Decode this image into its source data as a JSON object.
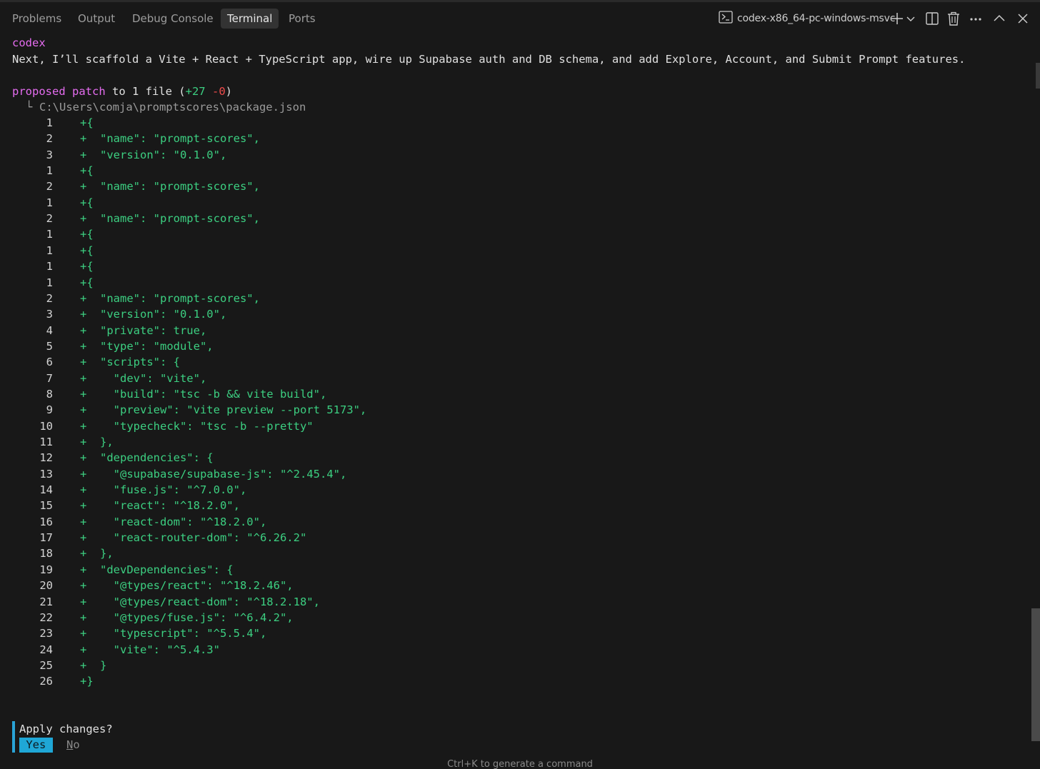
{
  "tabs": [
    {
      "label": "Problems"
    },
    {
      "label": "Output"
    },
    {
      "label": "Debug Console"
    },
    {
      "label": "Terminal",
      "active": true
    },
    {
      "label": "Ports"
    }
  ],
  "terminal_selector": {
    "icon": "terminal-icon",
    "label": "codex-x86_64-pc-windows-msvc"
  },
  "toolbar_icons": [
    "plus-icon",
    "chevron-down-icon",
    "split-icon",
    "trash-icon",
    "ellipsis-icon",
    "chevron-up-icon",
    "close-icon"
  ],
  "content": {
    "speaker": "codex",
    "message": "Next, I’ll scaffold a Vite + React + TypeScript app, wire up Supabase auth and DB schema, and add Explore, Account, and Submit Prompt features.",
    "patch_label": "proposed patch",
    "patch_to": " to 1 file (",
    "patch_added": "+27",
    "patch_space": " ",
    "patch_removed": "-0",
    "patch_close": ")",
    "file_tree_glyph": "└",
    "file_path": "C:\\Users\\comja\\promptscores\\package.json",
    "diff_lines": [
      {
        "num": "1",
        "code": "+{"
      },
      {
        "num": "2",
        "code": "+  \"name\": \"prompt-scores\","
      },
      {
        "num": "3",
        "code": "+  \"version\": \"0.1.0\","
      },
      {
        "num": "1",
        "code": "+{"
      },
      {
        "num": "2",
        "code": "+  \"name\": \"prompt-scores\","
      },
      {
        "num": "1",
        "code": "+{"
      },
      {
        "num": "2",
        "code": "+  \"name\": \"prompt-scores\","
      },
      {
        "num": "1",
        "code": "+{"
      },
      {
        "num": "1",
        "code": "+{"
      },
      {
        "num": "1",
        "code": "+{"
      },
      {
        "num": "1",
        "code": "+{"
      },
      {
        "num": "2",
        "code": "+  \"name\": \"prompt-scores\","
      },
      {
        "num": "3",
        "code": "+  \"version\": \"0.1.0\","
      },
      {
        "num": "4",
        "code": "+  \"private\": true,"
      },
      {
        "num": "5",
        "code": "+  \"type\": \"module\","
      },
      {
        "num": "6",
        "code": "+  \"scripts\": {"
      },
      {
        "num": "7",
        "code": "+    \"dev\": \"vite\","
      },
      {
        "num": "8",
        "code": "+    \"build\": \"tsc -b && vite build\","
      },
      {
        "num": "9",
        "code": "+    \"preview\": \"vite preview --port 5173\","
      },
      {
        "num": "10",
        "code": "+    \"typecheck\": \"tsc -b --pretty\""
      },
      {
        "num": "11",
        "code": "+  },"
      },
      {
        "num": "12",
        "code": "+  \"dependencies\": {"
      },
      {
        "num": "13",
        "code": "+    \"@supabase/supabase-js\": \"^2.45.4\","
      },
      {
        "num": "14",
        "code": "+    \"fuse.js\": \"^7.0.0\","
      },
      {
        "num": "15",
        "code": "+    \"react\": \"^18.2.0\","
      },
      {
        "num": "16",
        "code": "+    \"react-dom\": \"^18.2.0\","
      },
      {
        "num": "17",
        "code": "+    \"react-router-dom\": \"^6.26.2\""
      },
      {
        "num": "18",
        "code": "+  },"
      },
      {
        "num": "19",
        "code": "+  \"devDependencies\": {"
      },
      {
        "num": "20",
        "code": "+    \"@types/react\": \"^18.2.46\","
      },
      {
        "num": "21",
        "code": "+    \"@types/react-dom\": \"^18.2.18\","
      },
      {
        "num": "22",
        "code": "+    \"@types/fuse.js\": \"^6.4.2\","
      },
      {
        "num": "23",
        "code": "+    \"typescript\": \"^5.5.4\","
      },
      {
        "num": "24",
        "code": "+    \"vite\": \"^5.4.3\""
      },
      {
        "num": "25",
        "code": "+  }"
      },
      {
        "num": "26",
        "code": "+}"
      }
    ]
  },
  "prompt": {
    "question": "Apply changes?",
    "yes": " Yes",
    "no_first": "N",
    "no_rest": "o"
  },
  "hint": "Ctrl+K to generate a command",
  "colors": {
    "background": "#181818",
    "accent": "#1fa7d6",
    "speaker": "#e56cf0",
    "added": "#3ccf81",
    "removed": "#f14c4c"
  }
}
